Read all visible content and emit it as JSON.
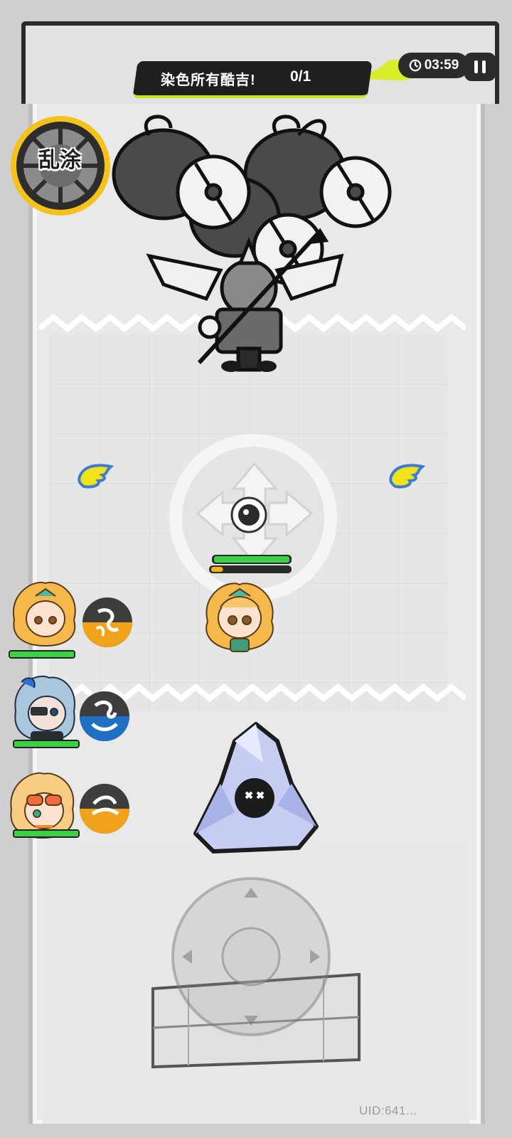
{
  "hud": {
    "objective_text": "染色所有酷吉!",
    "objective_progress": "0/1",
    "timer": "03:59",
    "skill_badge": "乱涂"
  },
  "watermark": {
    "uid": "UID:641..."
  },
  "party": [
    {
      "name": "blonde-hero",
      "hp_fraction": 1.0,
      "skill_color": "#f0a21b"
    },
    {
      "name": "blue-hair-hero",
      "hp_fraction": 1.0,
      "skill_color": "#1f6fc4"
    },
    {
      "name": "sunglasses-hero",
      "hp_fraction": 1.0,
      "skill_color": "#f0a21b"
    }
  ],
  "player": {
    "hp_fraction": 1.0,
    "energy_fraction": 0.15
  },
  "colors": {
    "accent": "#c9e41c",
    "hp_green": "#3cd145",
    "energy_yellow": "#f3b51c",
    "hud_dark": "#1f1f1f",
    "wing_yellow": "#f2e21a",
    "wing_blue": "#3a7bd5"
  },
  "icons": [
    "timer-icon",
    "pause-icon",
    "wing-icon",
    "ball-icon",
    "joystick-icon",
    "skill-icon"
  ]
}
